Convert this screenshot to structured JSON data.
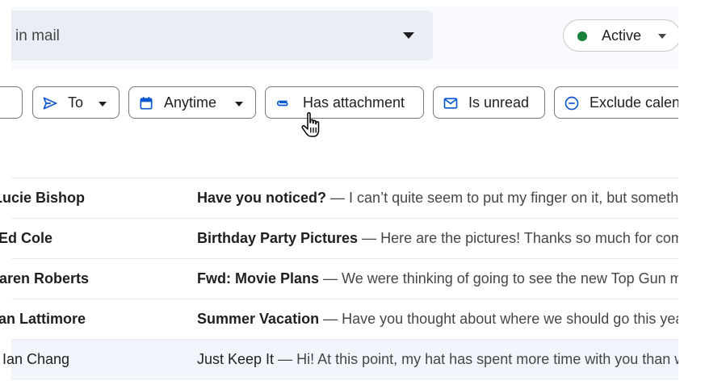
{
  "search": {
    "query": "in mail"
  },
  "status": {
    "label": "Active",
    "color": "#188038"
  },
  "filters": {
    "to": {
      "label": "To"
    },
    "anytime": {
      "label": "Anytime"
    },
    "attachment": {
      "label": "Has attachment"
    },
    "unread": {
      "label": "Is unread"
    },
    "exclude": {
      "label": "Exclude calendar updates"
    }
  },
  "emails": [
    {
      "sender": "Lucie Bishop",
      "subject": "Have you noticed?",
      "dash": " — ",
      "snippet": "I can’t quite seem to put my finger on it, but something seems different",
      "read": false
    },
    {
      "sender": "Ed Cole",
      "subject": "Birthday Party Pictures",
      "dash": " — ",
      "snippet": "Here are the pictures! Thanks so much for coming",
      "read": false
    },
    {
      "sender": "Karen Roberts",
      "subject": "Fwd: Movie Plans",
      "dash": " — ",
      "snippet": "We were thinking of going to see the new Top Gun movie",
      "read": false
    },
    {
      "sender": "Dan Lattimore",
      "subject": "Summer Vacation",
      "dash": " — ",
      "snippet": "Have you thought about where we should go this year?",
      "read": false
    },
    {
      "sender": "Ian Chang",
      "subject": "Just Keep It",
      "dash": " — ",
      "snippet": "Hi! At this point, my hat has spent more time with you than with me",
      "read": true
    }
  ]
}
